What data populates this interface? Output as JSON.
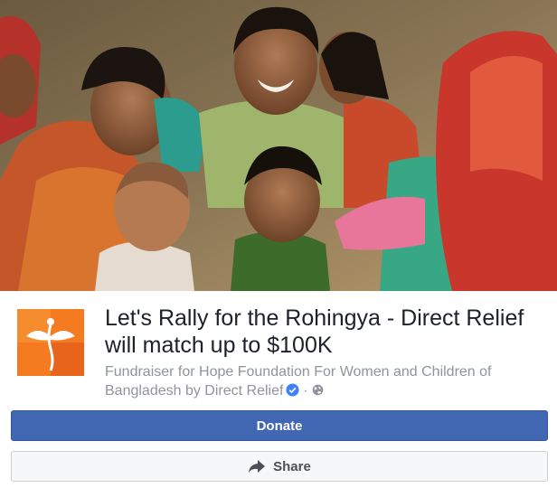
{
  "cover": {
    "description_icon": "photo-of-children"
  },
  "fundraiser": {
    "logo_icon": "hope-foundation-logo",
    "title": "Let's Rally for the Rohingya - Direct Relief will match up to $100K",
    "subtitle_prefix": "Fundraiser for Hope Foundation For Women and Children of Bangladesh by Direct Relief",
    "verified_icon": "verified-badge-icon",
    "separator": "·",
    "privacy_icon": "globe-icon"
  },
  "actions": {
    "donate_label": "Donate",
    "share_label": "Share",
    "share_icon": "share-arrow-icon"
  },
  "colors": {
    "donate_bg": "#4267b2",
    "share_bg": "#f6f7f9",
    "title_text": "#1d2129",
    "subtitle_text": "#90949c",
    "logo_orange": "#f47b20"
  }
}
